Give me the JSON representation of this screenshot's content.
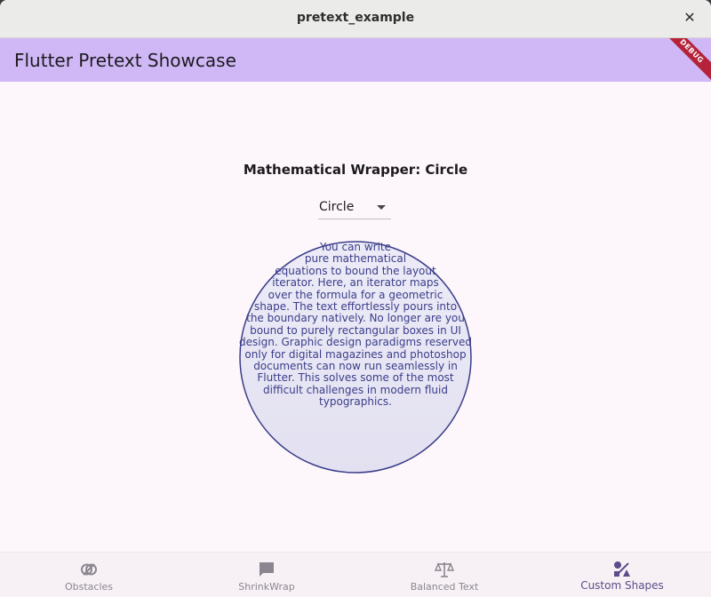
{
  "window": {
    "title": "pretext_example",
    "close_glyph": "✕"
  },
  "appbar": {
    "title": "Flutter Pretext Showcase",
    "debug_label": "DEBUG",
    "color": "#d0b8f6"
  },
  "main": {
    "heading": "Mathematical Wrapper: Circle",
    "shape_dropdown": {
      "selected": "Circle"
    },
    "circle": {
      "stroke_color": "#3b3d8a",
      "fill_color": "#e7e4f3",
      "lines": [
        "You can write",
        "pure mathematical",
        "equations to bound the layout",
        "iterator. Here, an iterator maps",
        "over the formula for a geometric",
        "shape. The text effortlessly pours into",
        "the boundary natively. No longer are you",
        "bound to purely rectangular boxes in UI",
        "design. Graphic design paradigms reserved",
        "only for digital magazines and photoshop",
        "documents can now run seamlessly in",
        "Flutter. This solves some of the most",
        "difficult challenges in modern fluid",
        "typographics."
      ]
    }
  },
  "navbar": {
    "items": [
      {
        "label": "Obstacles",
        "icon": "obstacles-icon",
        "active": false
      },
      {
        "label": "ShrinkWrap",
        "icon": "chat-bubble-icon",
        "active": false
      },
      {
        "label": "Balanced Text",
        "icon": "balance-scale-icon",
        "active": false
      },
      {
        "label": "Custom Shapes",
        "icon": "shapes-icon",
        "active": true
      }
    ],
    "active_color": "#5a4d8a",
    "inactive_color": "#8a8690"
  }
}
